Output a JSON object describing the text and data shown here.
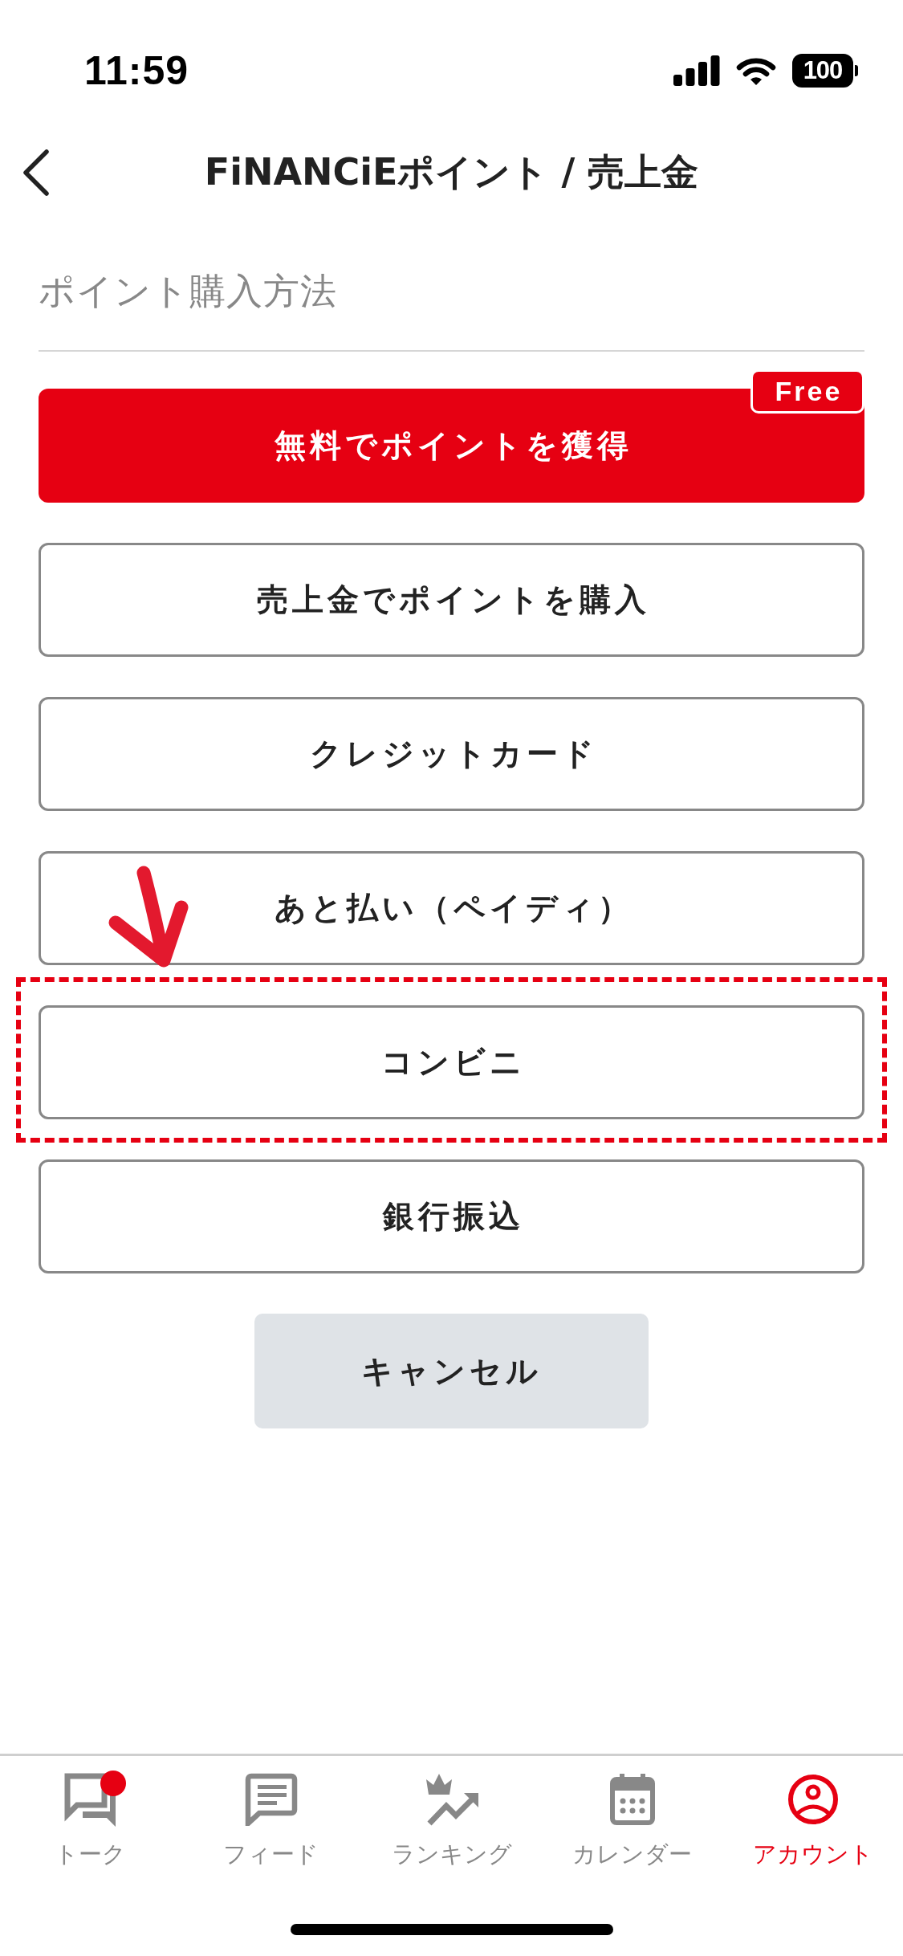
{
  "status_bar": {
    "time": "11:59",
    "battery": "100"
  },
  "header": {
    "title": "FiNANCiEポイント / 売上金"
  },
  "section": {
    "title": "ポイント購入方法"
  },
  "methods": [
    {
      "label": "無料でポイントを獲得",
      "kind": "primary",
      "badge": "Free",
      "highlighted": false
    },
    {
      "label": "売上金でポイントを購入",
      "kind": "outline",
      "highlighted": false
    },
    {
      "label": "クレジットカード",
      "kind": "outline",
      "highlighted": false
    },
    {
      "label": "あと払い（ペイディ）",
      "kind": "outline",
      "highlighted": false
    },
    {
      "label": "コンビニ",
      "kind": "outline",
      "highlighted": true
    },
    {
      "label": "銀行振込",
      "kind": "outline",
      "highlighted": false
    }
  ],
  "cancel": {
    "label": "キャンセル"
  },
  "tab_bar": {
    "tabs": [
      {
        "label": "トーク",
        "selected": false,
        "badge": true
      },
      {
        "label": "フィード",
        "selected": false,
        "badge": false
      },
      {
        "label": "ランキング",
        "selected": false,
        "badge": false
      },
      {
        "label": "カレンダー",
        "selected": false,
        "badge": false
      },
      {
        "label": "アカウント",
        "selected": true,
        "badge": false
      }
    ]
  }
}
